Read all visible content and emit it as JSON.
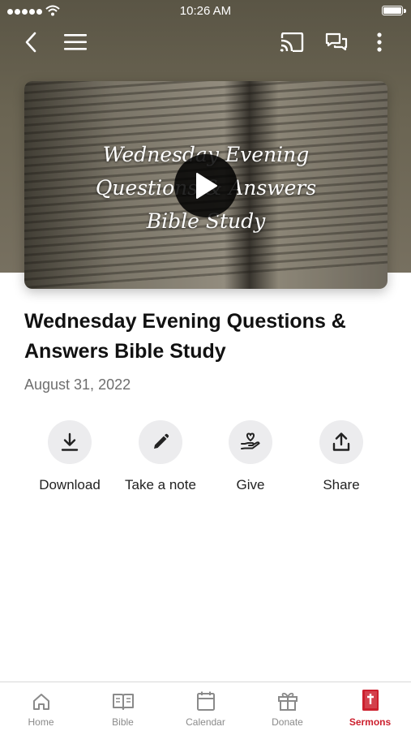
{
  "status_bar": {
    "time": "10:26 AM"
  },
  "video": {
    "overlay_lines": [
      "Wednesday Evening",
      "Questions & Answers",
      "Bible Study"
    ]
  },
  "sermon": {
    "title": "Wednesday Evening Questions & Answers Bible Study",
    "date": "August 31, 2022"
  },
  "actions": [
    {
      "label": "Download",
      "icon": "download-icon"
    },
    {
      "label": "Take a note",
      "icon": "pencil-icon"
    },
    {
      "label": "Give",
      "icon": "give-hand-heart-icon"
    },
    {
      "label": "Share",
      "icon": "share-icon"
    }
  ],
  "tabs": [
    {
      "label": "Home",
      "icon": "home-icon"
    },
    {
      "label": "Bible",
      "icon": "bible-book-icon"
    },
    {
      "label": "Calendar",
      "icon": "calendar-icon"
    },
    {
      "label": "Donate",
      "icon": "gift-icon"
    },
    {
      "label": "Sermons",
      "icon": "sermons-book-icon",
      "active": true
    }
  ],
  "colors": {
    "accent": "#cc1f2d",
    "header_bg": "#6a6452"
  }
}
